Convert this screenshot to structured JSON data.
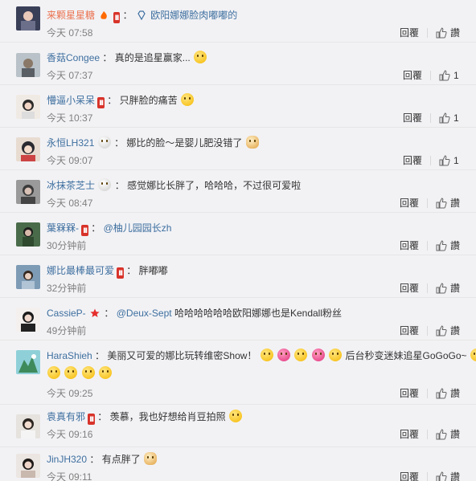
{
  "ui": {
    "reply_label": "回覆",
    "like_icon": "thumbs-up-icon",
    "accent_orange": "#eb7350",
    "link_blue": "#3e6f9f",
    "vip_red": "#d8332a"
  },
  "comments": [
    {
      "user": "来颗星星糖",
      "text": "欧阳娜娜脸肉嘟嘟的",
      "time": "今天 07:58",
      "likes": "讚"
    },
    {
      "user": "香菇Congee",
      "text": "真的是追星赢家...",
      "time": "今天 07:37",
      "likes": "1"
    },
    {
      "user": "懵逼小呆呆",
      "text": "只胖脸的痛苦",
      "time": "今天 10:37",
      "likes": "1"
    },
    {
      "user": "永恒LH321",
      "text": "娜比的脸～是婴儿肥没错了",
      "time": "今天 09:07",
      "likes": "1"
    },
    {
      "user": "冰抹茶芝士",
      "text": "感觉娜比长胖了，哈哈哈，不过很可爱啦",
      "time": "今天 08:47",
      "likes": "讚"
    },
    {
      "user": "葉槑槑-",
      "mention": "@柚儿园园长zh",
      "time": "30分钟前",
      "likes": "讚"
    },
    {
      "user": "娜比最棒最可爱",
      "text": "胖嘟嘟",
      "time": "32分钟前",
      "likes": "讚"
    },
    {
      "user": "CassieP-",
      "mention": "@Deux-Sept",
      "text": "哈哈哈哈哈哈欧阳娜娜也是Kendall粉丝",
      "time": "49分钟前",
      "likes": "讚"
    },
    {
      "user": "HaraShieh",
      "text": "美丽又可爱的娜比玩转维密Show！",
      "text2": "后台秒变迷妹追星GoGoGo~",
      "time": "今天 09:25",
      "likes": "讚"
    },
    {
      "user": "袁真有邪",
      "text": "羡慕，我也好想给肖豆拍照",
      "time": "今天 09:16",
      "likes": "讚"
    },
    {
      "user": "JinJH320",
      "text": "有点胖了",
      "time": "今天 09:11",
      "likes": "讚"
    }
  ],
  "vip_label": "III"
}
